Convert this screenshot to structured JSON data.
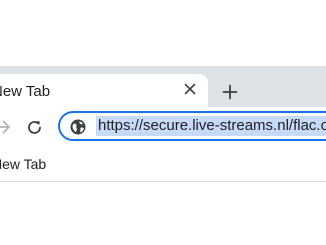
{
  "tabs": [
    {
      "title": "New Tab",
      "active": true
    }
  ],
  "omnibox": {
    "url": "https://secure.live-streams.nl/flac.ogg"
  },
  "bookmarks_bar": {
    "items": [
      {
        "label": "New Tab"
      }
    ]
  },
  "icons": {
    "close": "close-icon",
    "new_tab": "plus-icon",
    "forward": "forward-arrow-icon",
    "reload": "reload-icon",
    "site_info": "globe-icon"
  },
  "colors": {
    "tabstrip": "#dee1e6",
    "omnibox_border": "#1a73e8",
    "selection": "#c7daf8",
    "icon": "#3c4043",
    "icon_disabled": "#b0b3b8"
  }
}
